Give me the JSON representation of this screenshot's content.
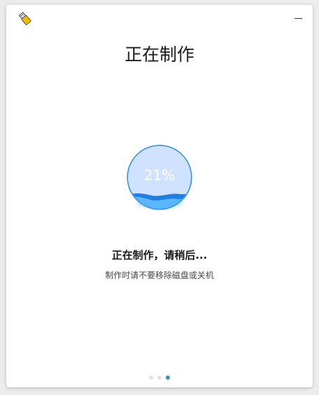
{
  "window": {
    "title": "正在制作",
    "icon": "usb-drive-icon"
  },
  "progress": {
    "value": 0.21,
    "label": "21%"
  },
  "status": {
    "main": "正在制作，请稍后...",
    "hint": "制作时请不要移除磁盘或关机"
  },
  "pager": {
    "total": 3,
    "current": 3
  },
  "colors": {
    "accent": "#2a8bea",
    "circle_fill": "#cfe2ff",
    "wave_light": "#5ab6ff",
    "wave_dark": "#1f7fe0"
  }
}
